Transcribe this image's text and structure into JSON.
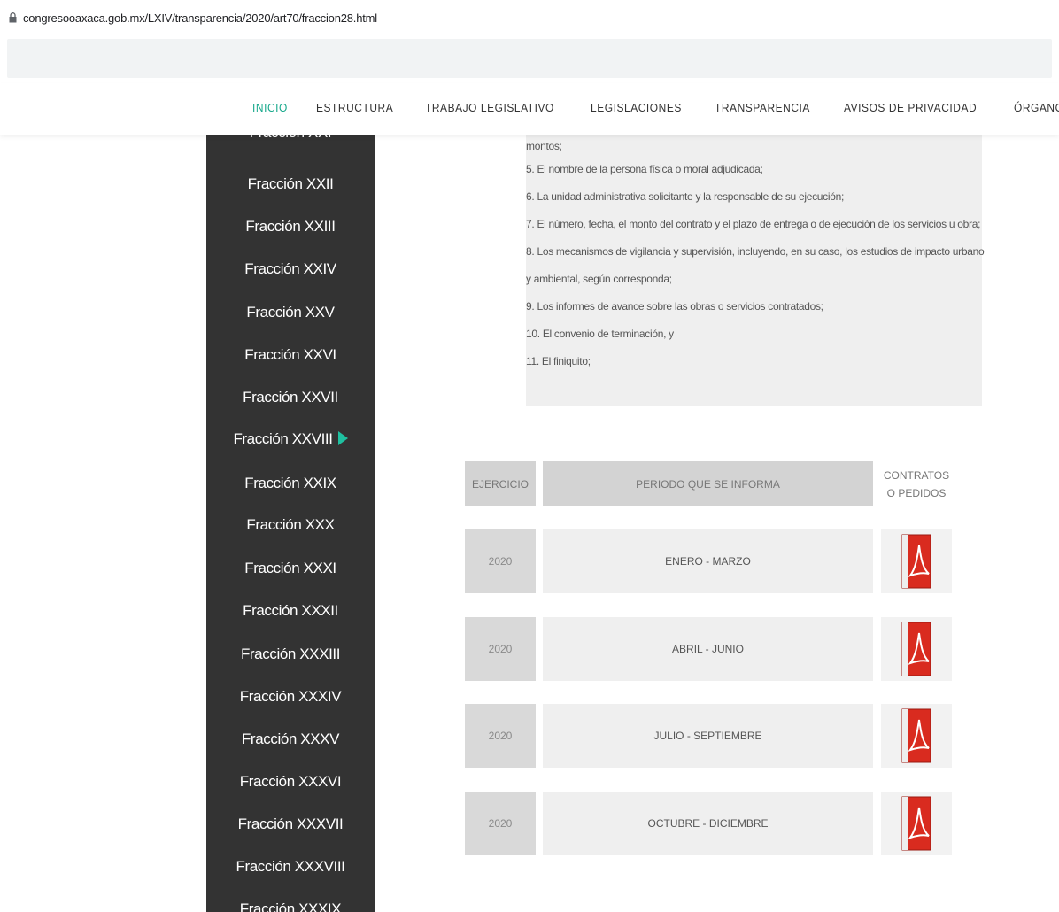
{
  "browser": {
    "url": "congresooaxaca.gob.mx/LXIV/transparencia/2020/art70/fraccion28.html"
  },
  "nav": {
    "items": [
      "INICIO",
      "ESTRUCTURA",
      "TRABAJO LEGISLATIVO",
      "LEGISLACIONES",
      "TRANSPARENCIA",
      "AVISOS DE PRIVACIDAD",
      "ÓRGANO INTERNO DE CONT"
    ],
    "active_index": 0,
    "accent_color": "#16a88b"
  },
  "sidebar": {
    "items": [
      "Fracción XXI",
      "Fracción XXII",
      "Fracción XXIII",
      "Fracción XXIV",
      "Fracción XXV",
      "Fracción XXVI",
      "Fracción XXVII",
      "Fracción XXVIII",
      "Fracción XXIX",
      "Fracción XXX",
      "Fracción XXXI",
      "Fracción XXXII",
      "Fracción XXXIII",
      "Fracción XXXIV",
      "Fracción XXXV",
      "Fracción XXXVI",
      "Fracción XXXVII",
      "Fracción XXXVIII",
      "Fracción XXXIX"
    ],
    "active_index": 7,
    "arrow_color": "#1fc0a0"
  },
  "content": {
    "lines": [
      "montos;",
      "5. El nombre de la persona física o moral adjudicada;",
      "6. La unidad administrativa solicitante y la responsable de su ejecución;",
      "7. El número, fecha, el monto del contrato y el plazo de entrega o de ejecución de los servicios u obra;",
      "8. Los mecanismos de vigilancia y supervisión, incluyendo, en su caso, los estudios de impacto urbano",
      "y ambiental, según corresponda;",
      "9. Los informes de avance sobre las obras o servicios contratados;",
      "10. El convenio de terminación, y",
      "11. El finiquito;"
    ]
  },
  "table": {
    "headers": {
      "year": "EJERCICIO",
      "period": "PERIODO QUE SE INFORMA",
      "contracts_line1": "CONTRATOS",
      "contracts_line2": "O PEDIDOS"
    },
    "rows": [
      {
        "year": "2020",
        "period": "ENERO - MARZO",
        "icon": "pdf-icon"
      },
      {
        "year": "2020",
        "period": "ABRIL - JUNIO",
        "icon": "pdf-icon"
      },
      {
        "year": "2020",
        "period": "JULIO - SEPTIEMBRE",
        "icon": "pdf-icon"
      },
      {
        "year": "2020",
        "period": "OCTUBRE - DICIEMBRE",
        "icon": "pdf-icon"
      }
    ]
  }
}
